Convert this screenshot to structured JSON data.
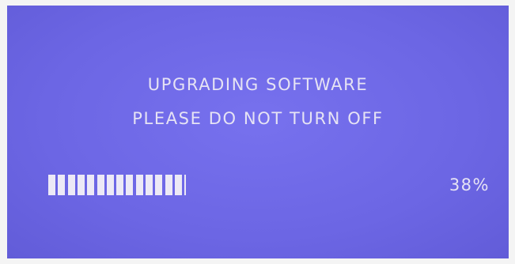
{
  "screen": {
    "title_line1": "UPGRADING SOFTWARE",
    "title_line2": "PLEASE DO NOT TURN OFF",
    "progress_label": "38%",
    "progress_fraction": 0.38,
    "colors": {
      "background": "#6f69e6",
      "text": "#e6e3f4"
    }
  }
}
